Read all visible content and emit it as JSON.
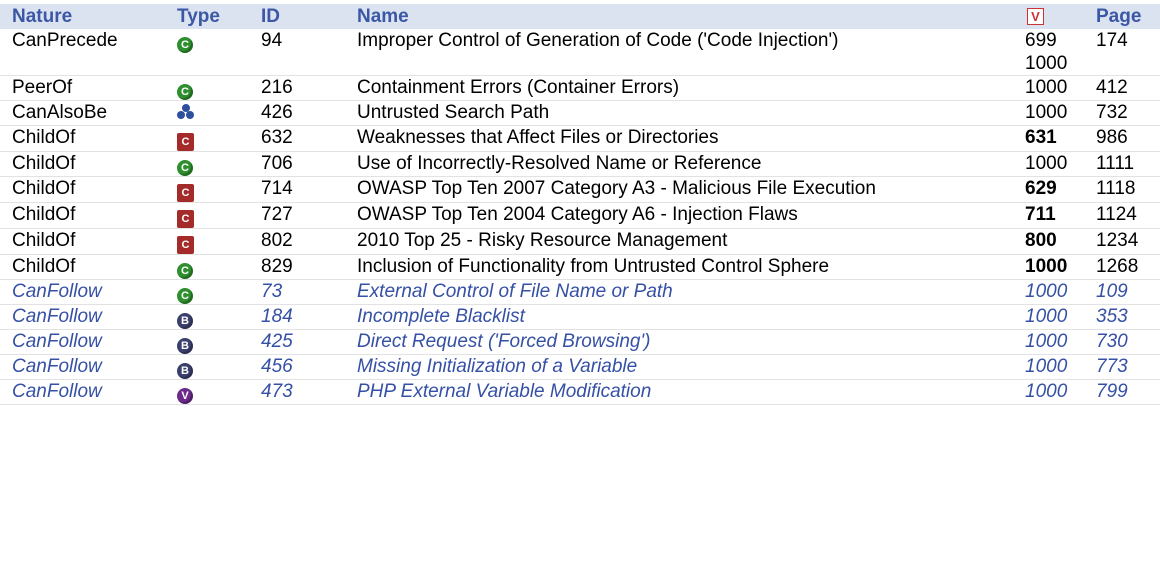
{
  "headers": {
    "nature": "Nature",
    "type": "Type",
    "id": "ID",
    "name": "Name",
    "view": "V",
    "page": "Page"
  },
  "rows": [
    {
      "nature": "CanPrecede",
      "icon": "category-circle-icon",
      "id": "94",
      "name": "Improper Control of Generation of Code ('Code Injection')",
      "views": [
        "699",
        "1000"
      ],
      "page": "174",
      "bold": false,
      "follow": false
    },
    {
      "nature": "PeerOf",
      "icon": "category-circle-icon",
      "id": "216",
      "name": "Containment Errors (Container Errors)",
      "views": [
        "1000"
      ],
      "page": "412",
      "bold": false,
      "follow": false
    },
    {
      "nature": "CanAlsoBe",
      "icon": "compound-icon",
      "id": "426",
      "name": "Untrusted Search Path",
      "views": [
        "1000"
      ],
      "page": "732",
      "bold": false,
      "follow": false
    },
    {
      "nature": "ChildOf",
      "icon": "category-square-icon",
      "id": "632",
      "name": "Weaknesses that Affect Files or Directories",
      "views": [
        "631"
      ],
      "page": "986",
      "bold": true,
      "follow": false
    },
    {
      "nature": "ChildOf",
      "icon": "category-circle-icon",
      "id": "706",
      "name": "Use of Incorrectly-Resolved Name or Reference",
      "views": [
        "1000"
      ],
      "page": "1111",
      "bold": false,
      "follow": false
    },
    {
      "nature": "ChildOf",
      "icon": "category-square-icon",
      "id": "714",
      "name": "OWASP Top Ten 2007 Category A3 - Malicious File Execution",
      "views": [
        "629"
      ],
      "page": "1118",
      "bold": true,
      "follow": false
    },
    {
      "nature": "ChildOf",
      "icon": "category-square-icon",
      "id": "727",
      "name": "OWASP Top Ten 2004 Category A6 - Injection Flaws",
      "views": [
        "711"
      ],
      "page": "1124",
      "bold": true,
      "follow": false
    },
    {
      "nature": "ChildOf",
      "icon": "category-square-icon",
      "id": "802",
      "name": "2010 Top 25 - Risky Resource Management",
      "views": [
        "800"
      ],
      "page": "1234",
      "bold": true,
      "follow": false
    },
    {
      "nature": "ChildOf",
      "icon": "category-circle-icon",
      "id": "829",
      "name": "Inclusion of Functionality from Untrusted Control Sphere",
      "views": [
        "1000"
      ],
      "page": "1268",
      "bold": true,
      "follow": false
    },
    {
      "nature": "CanFollow",
      "icon": "category-circle-icon",
      "id": "73",
      "name": "External Control of File Name or Path",
      "views": [
        "1000"
      ],
      "page": "109",
      "bold": false,
      "follow": true
    },
    {
      "nature": "CanFollow",
      "icon": "base-circle-icon",
      "id": "184",
      "name": "Incomplete Blacklist",
      "views": [
        "1000"
      ],
      "page": "353",
      "bold": false,
      "follow": true
    },
    {
      "nature": "CanFollow",
      "icon": "base-circle-icon",
      "id": "425",
      "name": "Direct Request ('Forced Browsing')",
      "views": [
        "1000"
      ],
      "page": "730",
      "bold": false,
      "follow": true
    },
    {
      "nature": "CanFollow",
      "icon": "base-circle-icon",
      "id": "456",
      "name": "Missing Initialization of a Variable",
      "views": [
        "1000"
      ],
      "page": "773",
      "bold": false,
      "follow": true
    },
    {
      "nature": "CanFollow",
      "icon": "variant-circle-icon",
      "id": "473",
      "name": "PHP External Variable Modification",
      "views": [
        "1000"
      ],
      "page": "799",
      "bold": false,
      "follow": true
    }
  ],
  "icon_glyphs": {
    "category-circle-icon": "C",
    "category-square-icon": "C",
    "base-circle-icon": "B",
    "variant-circle-icon": "V",
    "compound-icon": ""
  },
  "colors": {
    "header_bg": "#dbe3f0",
    "header_text": "#3b57a6",
    "follow_text": "#3550a5",
    "view_icon": "#cc3333"
  }
}
